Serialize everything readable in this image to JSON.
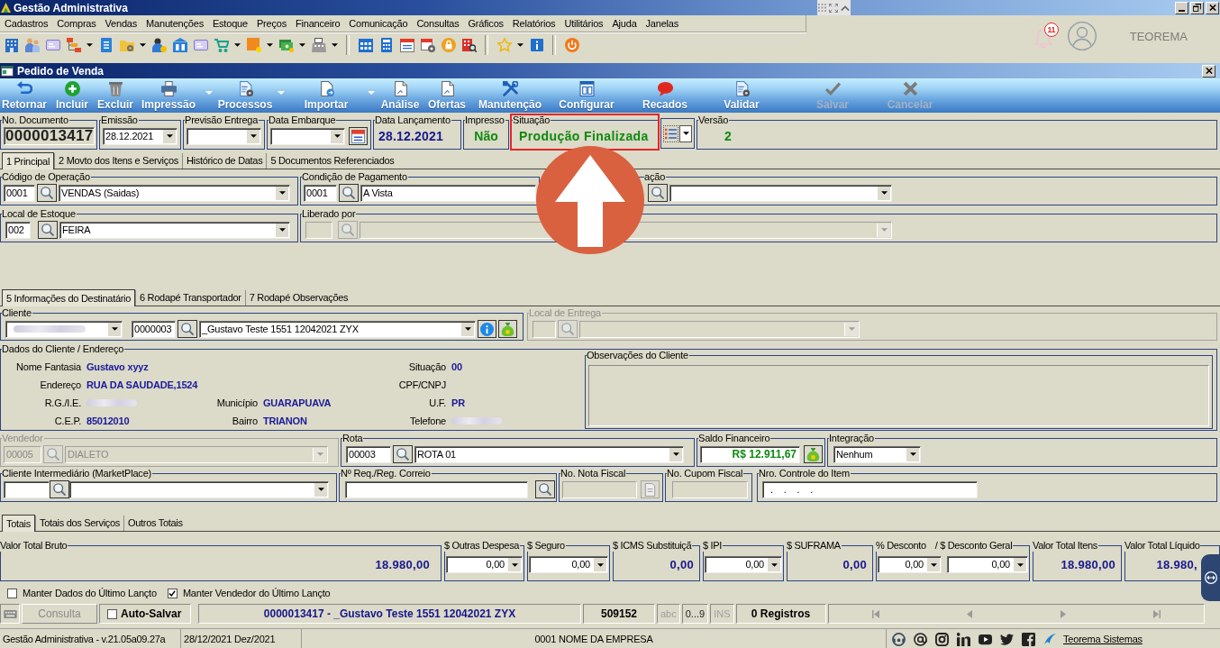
{
  "app_window": {
    "title": "Gestão Administrativa"
  },
  "menu": [
    "Cadastros",
    "Compras",
    "Vendas",
    "Manutenções",
    "Estoque",
    "Preços",
    "Financeiro",
    "Comunicação",
    "Consultas",
    "Gráficos",
    "Relatórios",
    "Utilitários",
    "Ajuda",
    "Janelas"
  ],
  "notifications": {
    "count": "11"
  },
  "user": {
    "name": "TEOREMA"
  },
  "form_window": {
    "title": "Pedido de Venda"
  },
  "toolbar": [
    {
      "label": "Retornar",
      "menu": false,
      "disabled": false
    },
    {
      "label": "Incluir",
      "menu": false,
      "disabled": false
    },
    {
      "label": "Excluir",
      "menu": false,
      "disabled": false
    },
    {
      "label": "Impressão",
      "menu": true,
      "disabled": false
    },
    {
      "label": "Processos",
      "menu": true,
      "disabled": false
    },
    {
      "label": "Importar",
      "menu": true,
      "disabled": false
    },
    {
      "label": "Análise",
      "menu": false,
      "disabled": false
    },
    {
      "label": "Ofertas",
      "menu": false,
      "disabled": false
    },
    {
      "label": "Manutenção",
      "menu": false,
      "disabled": false
    },
    {
      "label": "Configurar",
      "menu": false,
      "disabled": false
    },
    {
      "label": "Recados",
      "menu": false,
      "disabled": false
    },
    {
      "label": "Validar",
      "menu": false,
      "disabled": false
    },
    {
      "label": "Salvar",
      "menu": false,
      "disabled": true
    },
    {
      "label": "Cancelar",
      "menu": false,
      "disabled": true
    }
  ],
  "header": {
    "document_number": {
      "label": "No. Documento",
      "value": "0000013417"
    },
    "issue_date": {
      "label": "Emissão",
      "value": "28.12.2021"
    },
    "expected_delivery": {
      "label": "Previsão Entrega"
    },
    "shipping_date": {
      "label": "Data Embarque"
    },
    "entry_date": {
      "label": "Data Lançamento",
      "value": "28.12.2021"
    },
    "printed": {
      "label": "Impresso",
      "value": "Não"
    },
    "status": {
      "label": "Situação",
      "value": "Produção Finalizada",
      "highlighted": true
    },
    "version": {
      "label": "Versão",
      "value": "2"
    }
  },
  "main_tabs": [
    {
      "label": "1 Principal",
      "selected": true
    },
    {
      "label": "2 Movto dos Itens e Serviços",
      "selected": false
    },
    {
      "label": "Histórico de Datas",
      "selected": false
    },
    {
      "label": "5 Documentos Referenciados",
      "selected": false
    }
  ],
  "principal": {
    "operation": {
      "label": "Código de Operação",
      "code": "0001",
      "value": "VENDAS (Saidas)"
    },
    "payment": {
      "label": "Condição de Pagamento",
      "code": "0001",
      "value": "A Vista"
    },
    "group_3": {
      "label": "ação"
    },
    "stock": {
      "label": "Local de Estoque",
      "code": "002",
      "value": "FEIRA"
    },
    "released_by": {
      "label": "Liberado por",
      "readonly": true
    }
  },
  "detail_tabs": [
    {
      "label": "5 Informações do Destinatário",
      "selected": true
    },
    {
      "label": "6 Rodapé Transportador",
      "selected": false
    },
    {
      "label": "7 Rodapé Observações",
      "selected": false
    }
  ],
  "recipient": {
    "client": {
      "label": "Cliente",
      "id_redacted": true,
      "code": "0000003",
      "name": "_Gustavo Teste 1551 12042021 ZYX"
    },
    "delivery_place": {
      "label": "Local de Entrega",
      "disabled": true
    },
    "client_data": {
      "label": "Dados do Cliente / Endereço",
      "rows": [
        {
          "left": {
            "label": "Nome Fantasia",
            "value": "Gustavo xyyz"
          },
          "right": {
            "label": "Situação",
            "value": "00"
          }
        },
        {
          "left": {
            "label": "Endereço",
            "value": "RUA DA SAUDADE,1524"
          },
          "right": {
            "label": "CPF/CNPJ"
          }
        },
        {
          "left": {
            "label": "R.G./I.E.",
            "redacted": true
          },
          "middle": {
            "label": "Município",
            "value": "GUARAPUAVA"
          },
          "right": {
            "label": "U.F.",
            "value": "PR"
          }
        },
        {
          "left": {
            "label": "C.E.P.",
            "value": "85012010"
          },
          "middle": {
            "label": "Bairro",
            "value": "TRIANON"
          },
          "right": {
            "label": "Telefone",
            "redacted": true
          }
        }
      ]
    },
    "client_notes": {
      "label": "Observações do Cliente"
    },
    "seller": {
      "label": "Vendedor",
      "code": "00005",
      "value": "DIALETO",
      "disabled": true
    },
    "route": {
      "label": "Rota",
      "code": "00003",
      "value": "ROTA 01"
    },
    "balance": {
      "label": "Saldo Financeiro",
      "value": "R$ 12.911,67"
    },
    "integration": {
      "label": "Integração",
      "value": "Nenhum"
    },
    "intermediary": {
      "label": "Cliente Intermediário (MarketPlace)"
    },
    "mail_request": {
      "label": "Nº Req./Reg. Correio"
    },
    "invoice": {
      "label": "No. Nota Fiscal",
      "readonly": true
    },
    "coupon": {
      "label": "No. Cupom Fiscal",
      "readonly": true
    },
    "item_control": {
      "label": "Nro. Controle do Item",
      "value": ". . . ."
    }
  },
  "totals_tabs": [
    {
      "label": "Totais",
      "selected": true
    },
    {
      "label": "Totais dos Serviços",
      "selected": false
    },
    {
      "label": "Outros Totais",
      "selected": false
    }
  ],
  "totals": [
    {
      "kind": "total",
      "label": "Valor Total Bruto",
      "value": "18.980,00"
    },
    {
      "kind": "input",
      "label": "$ Outras Despesa",
      "value": "0,00"
    },
    {
      "kind": "input",
      "label": "$ Seguro",
      "value": "0,00"
    },
    {
      "kind": "total",
      "label": "$ ICMS Substituiçã",
      "value": "0,00"
    },
    {
      "kind": "input",
      "label": "$ IPI",
      "value": "0,00"
    },
    {
      "kind": "total",
      "label": "$ SUFRAMA",
      "value": "0,00"
    },
    {
      "kind": "pair",
      "label": "% Desconto",
      "label_2": "/ $ Desconto Geral",
      "value": "0,00",
      "value_2": "0,00"
    },
    {
      "kind": "total",
      "label": "Valor Total Itens",
      "value": "18.980,00"
    },
    {
      "kind": "total",
      "label": "Valor Total Líquido",
      "value": "18.980,"
    }
  ],
  "options": [
    {
      "label": "Manter Dados do Último Lançto",
      "checked": false
    },
    {
      "label": "Manter Vendedor do Último Lançto",
      "checked": true
    }
  ],
  "status_bar": {
    "mode": "Consulta",
    "auto_save": {
      "label": "Auto-Salvar",
      "checked": false
    },
    "record": "0000013417 - _Gustavo Teste 1551 12042021 ZYX",
    "code": "509152",
    "indicators": [
      {
        "label": "abc",
        "on": false
      },
      {
        "label": "0...9",
        "on": true
      },
      {
        "label": "INS",
        "on": false
      }
    ],
    "count": "0 Registros"
  },
  "footer": {
    "app_version": "Gestão Administrativa - v.21.05a09.27a",
    "period": "28/12/2021 Dez/2021",
    "company": "0001 NOME DA EMPRESA",
    "link": "Teorema Sistemas"
  }
}
